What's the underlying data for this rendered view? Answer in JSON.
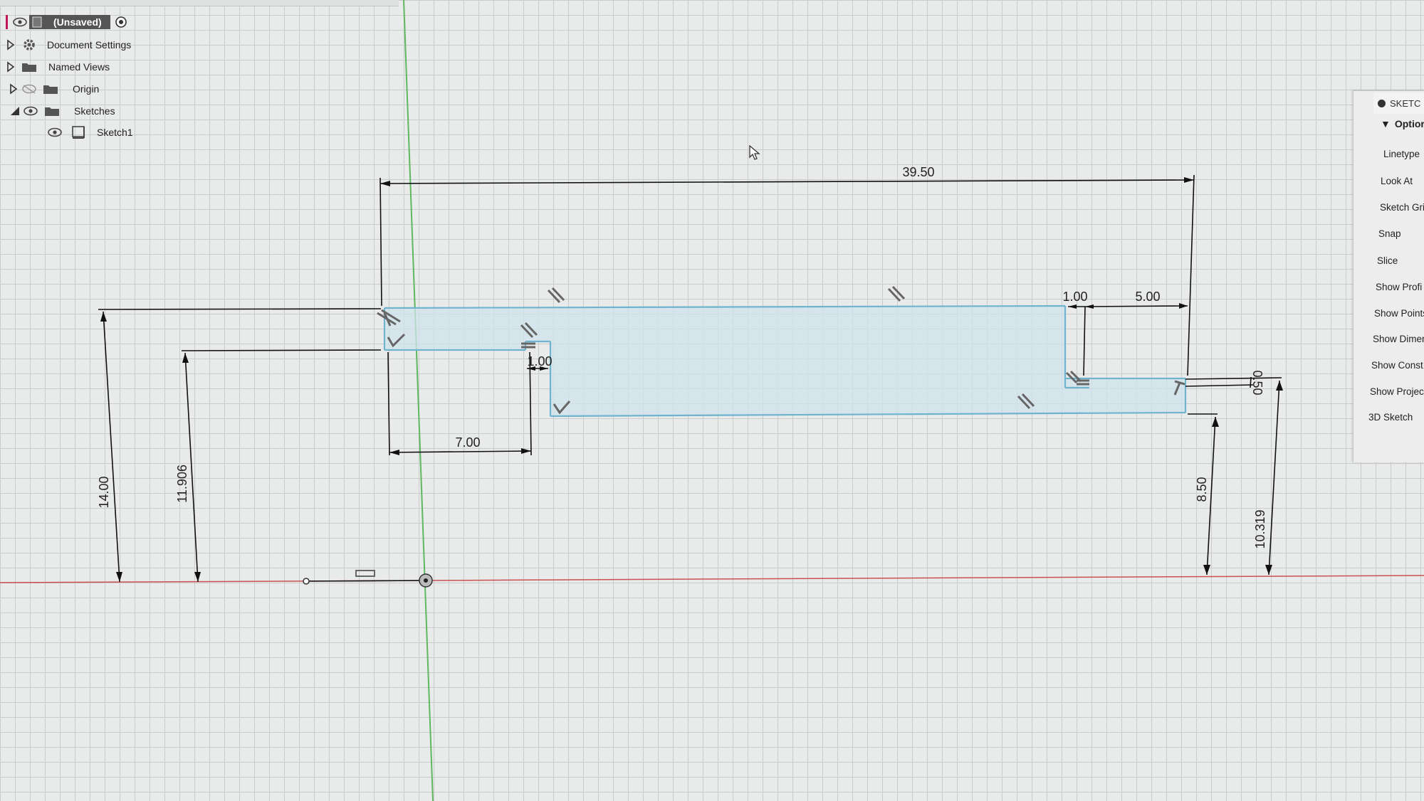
{
  "browser": {
    "root_label": "(Unsaved)",
    "items": [
      {
        "label": "Document Settings",
        "icon": "gear-icon",
        "expanded": false
      },
      {
        "label": "Named Views",
        "icon": "folder-icon",
        "expanded": false
      },
      {
        "label": "Origin",
        "icon": "folder-icon",
        "expanded": false,
        "visibility": "hidden"
      },
      {
        "label": "Sketches",
        "icon": "folder-icon",
        "expanded": true,
        "visibility": "visible"
      },
      {
        "label": "Sketch1",
        "icon": "sketch-icon",
        "visibility": "visible"
      }
    ]
  },
  "palette": {
    "title": "SKETC",
    "section": "Optior",
    "items": [
      "Linetype",
      "Look At",
      "Sketch Gri",
      "Snap",
      "Slice",
      "Show Profi",
      "Show Points",
      "Show Dimen",
      "Show Const",
      "Show Projec",
      "3D Sketch"
    ]
  },
  "dimensions": {
    "overall_width": "39.50",
    "right_step_width": "5.00",
    "right_gap": "1.00",
    "left_gap": "1.00",
    "left_step_width": "7.00",
    "left_height": "14.00",
    "left_inner_height": "11.906",
    "right_height": "8.50",
    "right_outer_height": "10.319",
    "right_offset": "0.50"
  },
  "colors": {
    "profile_fill": "#cfe3ec",
    "profile_edge": "#6fb3cf",
    "axis_green": "#4caf50",
    "axis_red": "#c94a4a"
  }
}
